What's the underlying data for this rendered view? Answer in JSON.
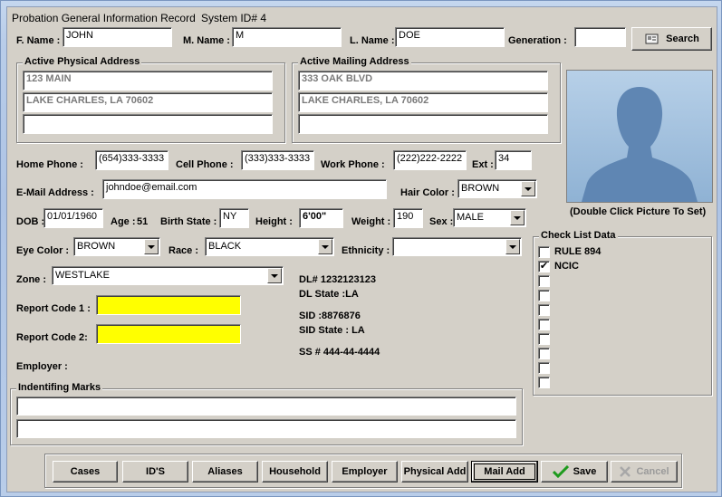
{
  "window": {
    "title": "Probation General Information Record",
    "system_id": "System ID# 4"
  },
  "name": {
    "first_label": "F. Name :",
    "first_value": "JOHN",
    "middle_label": "M. Name :",
    "middle_value": "M",
    "last_label": "L. Name :",
    "last_value": "DOE",
    "generation_label": "Generation :",
    "generation_value": "",
    "search_label": "Search"
  },
  "physical_address": {
    "title": "Active Physical Address",
    "line1": "123 MAIN",
    "line2": "LAKE CHARLES, LA 70602",
    "line3": ""
  },
  "mailing_address": {
    "title": "Active Mailing Address",
    "line1": "333 OAK BLVD",
    "line2": "LAKE CHARLES, LA 70602",
    "line3": ""
  },
  "photo": {
    "caption": "(Double Click Picture To Set)"
  },
  "phones": {
    "home_label": "Home Phone :",
    "home_value": "(654)333-3333",
    "cell_label": "Cell Phone :",
    "cell_value": "(333)333-3333",
    "work_label": "Work Phone :",
    "work_value": "(222)222-2222",
    "ext_label": "Ext :",
    "ext_value": "34"
  },
  "email": {
    "label": "E-Mail Address :",
    "value": "johndoe@email.com"
  },
  "hair": {
    "label": "Hair Color :",
    "value": "BROWN"
  },
  "dob": {
    "label": "DOB :",
    "value": "01/01/1960",
    "age_label": "Age :",
    "age_value": "51"
  },
  "birth_state": {
    "label": "Birth State :",
    "value": "NY"
  },
  "height": {
    "label": "Height :",
    "value": "6'00\""
  },
  "weight": {
    "label": "Weight :",
    "value": "190"
  },
  "sex": {
    "label": "Sex :",
    "value": "MALE"
  },
  "eye": {
    "label": "Eye Color :",
    "value": "BROWN"
  },
  "race": {
    "label": "Race :",
    "value": "BLACK"
  },
  "ethnicity": {
    "label": "Ethnicity :",
    "value": ""
  },
  "zone": {
    "label": "Zone :",
    "value": "WESTLAKE"
  },
  "report_codes": {
    "code1_label": "Report Code 1 :",
    "code1_value": "",
    "code2_label": "Report Code 2:",
    "code2_value": ""
  },
  "employer": {
    "label": "Employer :"
  },
  "ids": {
    "dl": "DL# 1232123123",
    "dl_state": "DL State :LA",
    "sid": "SID :8876876",
    "sid_state": "SID State : LA",
    "ss": "SS # 444-44-4444"
  },
  "checklist": {
    "title": "Check List Data",
    "items": [
      {
        "label": "RULE 894",
        "checked": false
      },
      {
        "label": "NCIC",
        "checked": true
      },
      {
        "label": "",
        "checked": false
      },
      {
        "label": "",
        "checked": false
      },
      {
        "label": "",
        "checked": false
      },
      {
        "label": "",
        "checked": false
      },
      {
        "label": "",
        "checked": false
      },
      {
        "label": "",
        "checked": false
      },
      {
        "label": "",
        "checked": false
      },
      {
        "label": "",
        "checked": false
      }
    ]
  },
  "marks": {
    "title": "Indentifing Marks",
    "line1": "",
    "line2": ""
  },
  "buttons": {
    "cases": "Cases",
    "ids": "ID'S",
    "aliases": "Aliases",
    "household": "Household",
    "employer": "Employer",
    "physical_add": "Physical Add",
    "mail_add": "Mail Add",
    "save": "Save",
    "cancel": "Cancel"
  },
  "colors": {
    "highlight": "#ffff00",
    "silhouette": "#5f86b3",
    "photo_bg": "#9fbfdc"
  }
}
